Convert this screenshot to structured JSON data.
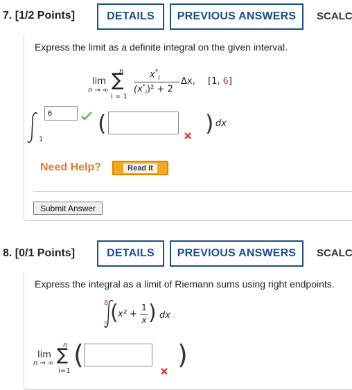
{
  "question7": {
    "title": "7. [1/2 Points]",
    "details_label": "DETAILS",
    "previous_answers_label": "PREVIOUS ANSWERS",
    "source_label": "SCALC",
    "prompt": "Express the limit as a definite integral on the given interval.",
    "limit_expr": {
      "lim": "lim",
      "lim_sub": "n → ∞",
      "sum_top": "n",
      "sum_bottom": "i = 1",
      "numerator": "x",
      "numerator_sup": "*",
      "numerator_sub": "i",
      "denominator": "(x",
      "denominator_rest": ")² + 2",
      "delta": "Δx,",
      "interval_open": "[1, ",
      "interval_end": "6",
      "interval_close": "]"
    },
    "upper_limit_value": "6",
    "lower_limit": "1",
    "integrand_value": "",
    "dx": "dx",
    "need_help_label": "Need Help?",
    "read_it_label": "Read It",
    "submit_label": "Submit Answer"
  },
  "question8": {
    "title": "8. [0/1 Points]",
    "details_label": "DETAILS",
    "previous_answers_label": "PREVIOUS ANSWERS",
    "source_label": "SCALC",
    "prompt": "Express the integral as a limit of Riemann sums using right endpoints.",
    "integral_expr": {
      "upper": "8",
      "lower": "5",
      "x2": "x² +",
      "frac_num": "1",
      "frac_den": "x",
      "dx": "dx"
    },
    "lim": "lim",
    "lim_sub": "n → ∞",
    "sum_top": "n",
    "sum_bottom": "i=1",
    "answer_value": ""
  },
  "colors": {
    "accent": "#1b4f8a",
    "help": "#e67e22",
    "correct": "#5cb85c",
    "incorrect": "#e53935"
  }
}
